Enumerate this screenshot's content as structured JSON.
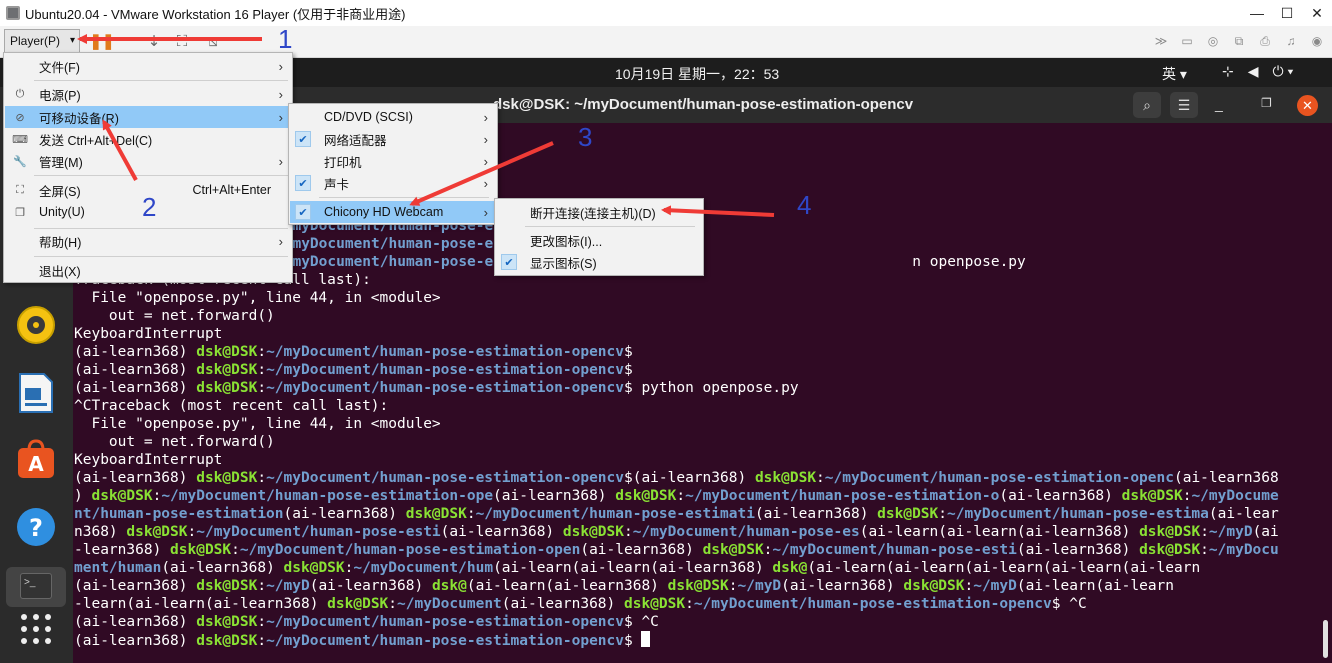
{
  "window": {
    "title": "Ubuntu20.04 - VMware Workstation 16 Player (仅用于非商业用途)",
    "minimize": "—",
    "maximize": "☐",
    "close": "✕"
  },
  "toolbar": {
    "player_label": "Player(P)"
  },
  "topbar": {
    "clock": "10月19日 星期一，22：53",
    "ime": "英 ▾"
  },
  "terminal": {
    "title": "dsk@DSK: ~/myDocument/human-pose-estimation-opencv",
    "lines": [
      [
        [
          "w",
          "  File \"openpose.py\", line 44, in <module>"
        ]
      ],
      [
        [
          "w",
          "    out = net.forward()"
        ]
      ],
      [
        [
          "w",
          "KeyboardInterrupt"
        ]
      ],
      [
        [
          "w",
          "(ai-learn368) "
        ],
        [
          "g",
          "dsk@DSK"
        ],
        [
          "w",
          ":"
        ],
        [
          "b",
          "~/myDocument/human-pose-estimation-opencv"
        ],
        [
          "w",
          "$"
        ]
      ],
      [
        [
          "w",
          "(ai-learn368) "
        ],
        [
          "g",
          "dsk@DSK"
        ],
        [
          "w",
          ":"
        ],
        [
          "b",
          "~/myDocument/human-pose-estimation-opencv"
        ],
        [
          "w",
          "$"
        ]
      ],
      [
        [
          "w",
          "(ai-learn368) "
        ],
        [
          "g",
          "dsk@DSK"
        ],
        [
          "w",
          ":"
        ],
        [
          "b",
          "~/myDocument/human-pose-estimation-opencv"
        ],
        [
          "w",
          "$ python openpose.py"
        ]
      ],
      [
        [
          "w",
          "^CTraceback (most recent call last):"
        ]
      ],
      [
        [
          "w",
          "  File \"openpose.py\", line 44, in <module>"
        ]
      ],
      [
        [
          "w",
          "    out = net.forward()"
        ]
      ],
      [
        [
          "w",
          "KeyboardInterrupt"
        ]
      ],
      [
        [
          "w",
          "(ai-learn368) "
        ],
        [
          "g",
          "dsk@DSK"
        ],
        [
          "w",
          ":"
        ],
        [
          "b",
          "~/myDocument/human-pose-estimation-opencv"
        ],
        [
          "w",
          "$(ai-learn368) "
        ],
        [
          "g",
          "dsk@DSK"
        ],
        [
          "w",
          ":"
        ],
        [
          "b",
          "~/myDocument/human-pose-estimation-openc"
        ],
        [
          "w",
          "(ai-learn368"
        ]
      ],
      [
        [
          "w",
          ") "
        ],
        [
          "g",
          "dsk@DSK"
        ],
        [
          "w",
          ":"
        ],
        [
          "b",
          "~/myDocument/human-pose-estimation-ope"
        ],
        [
          "w",
          "(ai-learn368) "
        ],
        [
          "g",
          "dsk@DSK"
        ],
        [
          "w",
          ":"
        ],
        [
          "b",
          "~/myDocument/human-pose-estimation-o"
        ],
        [
          "w",
          "(ai-learn368) "
        ],
        [
          "g",
          "dsk@DSK"
        ],
        [
          "w",
          ":"
        ],
        [
          "b",
          "~/myDocume"
        ]
      ],
      [
        [
          "b",
          "nt/human-pose-estimation"
        ],
        [
          "w",
          "(ai-learn368) "
        ],
        [
          "g",
          "dsk@DSK"
        ],
        [
          "w",
          ":"
        ],
        [
          "b",
          "~/myDocument/human-pose-estimati"
        ],
        [
          "w",
          "(ai-learn368) "
        ],
        [
          "g",
          "dsk@DSK"
        ],
        [
          "w",
          ":"
        ],
        [
          "b",
          "~/myDocument/human-pose-estima"
        ],
        [
          "w",
          "(ai-lear"
        ]
      ],
      [
        [
          "w",
          "n368) "
        ],
        [
          "g",
          "dsk@DSK"
        ],
        [
          "w",
          ":"
        ],
        [
          "b",
          "~/myDocument/human-pose-esti"
        ],
        [
          "w",
          "(ai-learn368) "
        ],
        [
          "g",
          "dsk@DSK"
        ],
        [
          "w",
          ":"
        ],
        [
          "b",
          "~/myDocument/human-pose-es"
        ],
        [
          "w",
          "(ai-learn(ai-learn(ai-learn368) "
        ],
        [
          "g",
          "dsk@DSK"
        ],
        [
          "w",
          ":"
        ],
        [
          "b",
          "~/myD"
        ],
        [
          "w",
          "(ai"
        ]
      ],
      [
        [
          "w",
          "-learn368) "
        ],
        [
          "g",
          "dsk@DSK"
        ],
        [
          "w",
          ":"
        ],
        [
          "b",
          "~/myDocument/human-pose-estimation-open"
        ],
        [
          "w",
          "(ai-learn368) "
        ],
        [
          "g",
          "dsk@DSK"
        ],
        [
          "w",
          ":"
        ],
        [
          "b",
          "~/myDocument/human-pose-esti"
        ],
        [
          "w",
          "(ai-learn368) "
        ],
        [
          "g",
          "dsk@DSK"
        ],
        [
          "w",
          ":"
        ],
        [
          "b",
          "~/myDocu"
        ]
      ],
      [
        [
          "b",
          "ment/human"
        ],
        [
          "w",
          "(ai-learn368) "
        ],
        [
          "g",
          "dsk@DSK"
        ],
        [
          "w",
          ":"
        ],
        [
          "b",
          "~/myDocument/hum"
        ],
        [
          "w",
          "(ai-learn(ai-learn(ai-learn368) "
        ],
        [
          "g",
          "dsk@"
        ],
        [
          "w",
          "(ai-learn(ai-learn(ai-learn(ai-learn(ai-learn"
        ]
      ],
      [
        [
          "w",
          "(ai-learn368) "
        ],
        [
          "g",
          "dsk@DSK"
        ],
        [
          "w",
          ":"
        ],
        [
          "b",
          "~/myD"
        ],
        [
          "w",
          "(ai-learn368) "
        ],
        [
          "g",
          "dsk@"
        ],
        [
          "w",
          "(ai-learn(ai-learn368) "
        ],
        [
          "g",
          "dsk@DSK"
        ],
        [
          "w",
          ":"
        ],
        [
          "b",
          "~/myD"
        ],
        [
          "w",
          "(ai-learn368) "
        ],
        [
          "g",
          "dsk@DSK"
        ],
        [
          "w",
          ":"
        ],
        [
          "b",
          "~/myD"
        ],
        [
          "w",
          "(ai-learn(ai-learn"
        ]
      ],
      [
        [
          "w",
          "-learn(ai-learn(ai-learn368) "
        ],
        [
          "g",
          "dsk@DSK"
        ],
        [
          "w",
          ":"
        ],
        [
          "b",
          "~/myDocument"
        ],
        [
          "w",
          "(ai-learn368) "
        ],
        [
          "g",
          "dsk@DSK"
        ],
        [
          "w",
          ":"
        ],
        [
          "b",
          "~/myDocument/human-pose-estimation-opencv"
        ],
        [
          "w",
          "$ ^C"
        ]
      ],
      [
        [
          "w",
          "(ai-learn368) "
        ],
        [
          "g",
          "dsk@DSK"
        ],
        [
          "w",
          ":"
        ],
        [
          "b",
          "~/myDocument/human-pose-estimation-opencv"
        ],
        [
          "w",
          "$ ^C"
        ]
      ],
      [
        [
          "w",
          "(ai-learn368) "
        ],
        [
          "g",
          "dsk@DSK"
        ],
        [
          "w",
          ":"
        ],
        [
          "b",
          "~/myDocument/human-pose-estimation-opencv"
        ],
        [
          "w",
          "$ "
        ]
      ]
    ],
    "hidden_lines": [
      [
        [
          "b",
          "~/myDocument/human-pose-e"
        ]
      ],
      [
        [
          "b",
          "~/myDocument/human-pose-e"
        ]
      ],
      [
        [
          "b",
          "~/myDocument/human-pose-e"
        ],
        [
          "w",
          "                                                n openpose.py"
        ]
      ],
      [
        [
          "w",
          "Traceback (most recent call last):"
        ]
      ]
    ]
  },
  "player_menu": {
    "items": [
      {
        "label": "文件(F)",
        "icon": "",
        "shortcut": "",
        "arrow": "›"
      },
      {
        "label": "电源(P)",
        "icon": "⏻",
        "shortcut": "",
        "arrow": "›"
      },
      {
        "label": "可移动设备(R)",
        "icon": "⊘",
        "shortcut": "",
        "arrow": "›"
      },
      {
        "label": "发送 Ctrl+Alt+Del(C)",
        "icon": "⌨",
        "shortcut": "",
        "arrow": ""
      },
      {
        "label": "管理(M)",
        "icon": "🔧",
        "shortcut": "",
        "arrow": "›"
      },
      {
        "label": "全屏(S)",
        "icon": "⛶",
        "shortcut": "Ctrl+Alt+Enter",
        "arrow": ""
      },
      {
        "label": "Unity(U)",
        "icon": "❐",
        "shortcut": "",
        "arrow": ""
      },
      {
        "label": "帮助(H)",
        "icon": "",
        "shortcut": "",
        "arrow": "›"
      },
      {
        "label": "退出(X)",
        "icon": "",
        "shortcut": "",
        "arrow": ""
      }
    ]
  },
  "devices_menu": {
    "items": [
      {
        "label": "CD/DVD (SCSI)",
        "checked": false
      },
      {
        "label": "网络适配器",
        "checked": true
      },
      {
        "label": "打印机",
        "checked": false
      },
      {
        "label": "声卡",
        "checked": true
      },
      {
        "label": "Chicony HD Webcam",
        "checked": true
      }
    ]
  },
  "webcam_menu": {
    "items": [
      {
        "label": "断开连接(连接主机)(D)",
        "checked": false
      },
      {
        "label": "更改图标(I)...",
        "checked": false
      },
      {
        "label": "显示图标(S)",
        "checked": true
      }
    ]
  },
  "annotations": {
    "n1": "1",
    "n2": "2",
    "n3": "3",
    "n4": "4"
  },
  "colors": {
    "terminal_bg": "#300a24",
    "prompt_user": "#8ae234",
    "prompt_path": "#729fcf",
    "menu_highlight": "#91c9f7",
    "arrow": "#ef3b36",
    "annotation": "#2f47c8"
  }
}
